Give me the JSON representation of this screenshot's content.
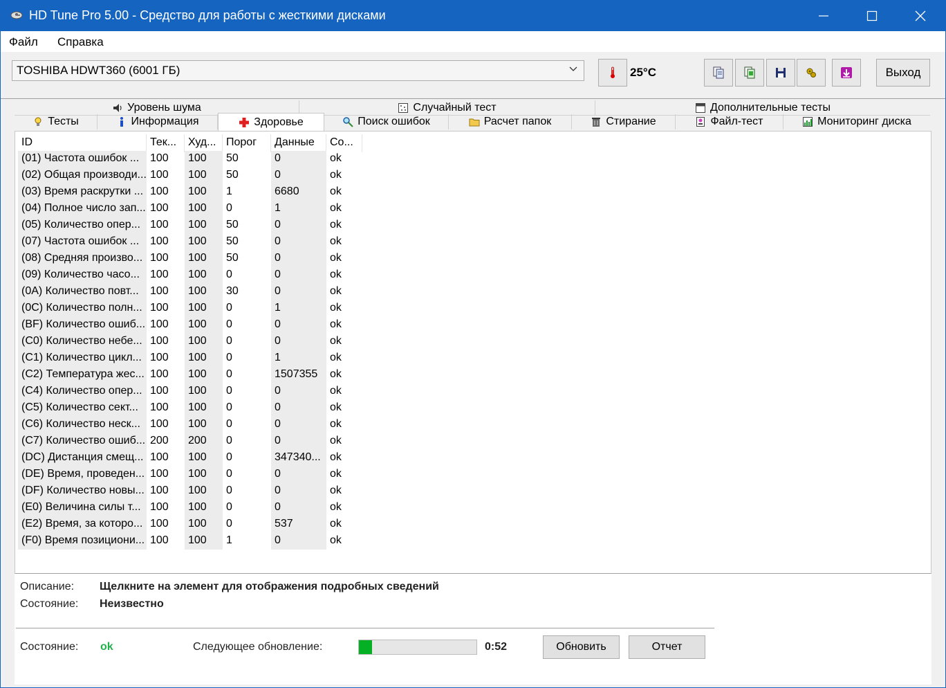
{
  "window": {
    "title": "HD Tune Pro 5.00 - Средство для работы с жесткими дисками"
  },
  "menu": {
    "items": [
      "Файл",
      "Справка"
    ]
  },
  "toolbar": {
    "drive": "TOSHIBA HDWT360 (6001 ГБ)",
    "temperature": "25°C",
    "exit_label": "Выход",
    "icons": [
      "thermometer-icon",
      "copy-text-icon",
      "copy-screenshot-icon",
      "save-icon",
      "options-icon",
      "download-icon"
    ]
  },
  "tabs": {
    "row1": [
      "Уровень шума",
      "Случайный тест",
      "Дополнительные тесты"
    ],
    "row2": [
      "Тесты",
      "Информация",
      "Здоровье",
      "Поиск ошибок",
      "Расчет папок",
      "Стирание",
      "Файл-тест",
      "Мониторинг диска"
    ],
    "active": "Здоровье"
  },
  "smart": {
    "columns": [
      "ID",
      "Тек...",
      "Худ...",
      "Порог",
      "Данные",
      "Со..."
    ],
    "rows": [
      [
        "(01) Частота ошибок ...",
        "100",
        "100",
        "50",
        "0",
        "ok"
      ],
      [
        "(02) Общая производи...",
        "100",
        "100",
        "50",
        "0",
        "ok"
      ],
      [
        "(03) Время раскрутки ...",
        "100",
        "100",
        "1",
        "6680",
        "ok"
      ],
      [
        "(04) Полное число зап...",
        "100",
        "100",
        "0",
        "1",
        "ok"
      ],
      [
        "(05) Количество опер...",
        "100",
        "100",
        "50",
        "0",
        "ok"
      ],
      [
        "(07) Частота ошибок ...",
        "100",
        "100",
        "50",
        "0",
        "ok"
      ],
      [
        "(08) Средняя произво...",
        "100",
        "100",
        "50",
        "0",
        "ok"
      ],
      [
        "(09) Количество часо...",
        "100",
        "100",
        "0",
        "0",
        "ok"
      ],
      [
        "(0A) Количество повт...",
        "100",
        "100",
        "30",
        "0",
        "ok"
      ],
      [
        "(0C) Количество полн...",
        "100",
        "100",
        "0",
        "1",
        "ok"
      ],
      [
        "(BF) Количество ошиб...",
        "100",
        "100",
        "0",
        "0",
        "ok"
      ],
      [
        "(C0) Количество небе...",
        "100",
        "100",
        "0",
        "0",
        "ok"
      ],
      [
        "(C1) Количество цикл...",
        "100",
        "100",
        "0",
        "1",
        "ok"
      ],
      [
        "(C2) Температура жес...",
        "100",
        "100",
        "0",
        "1507355",
        "ok"
      ],
      [
        "(C4) Количество опер...",
        "100",
        "100",
        "0",
        "0",
        "ok"
      ],
      [
        "(C5) Количество сект...",
        "100",
        "100",
        "0",
        "0",
        "ok"
      ],
      [
        "(C6) Количество неск...",
        "100",
        "100",
        "0",
        "0",
        "ok"
      ],
      [
        "(C7) Количество ошиб...",
        "200",
        "200",
        "0",
        "0",
        "ok"
      ],
      [
        "(DC) Дистанция смещ...",
        "100",
        "100",
        "0",
        "347340...",
        "ok"
      ],
      [
        "(DE) Время, проведен...",
        "100",
        "100",
        "0",
        "0",
        "ok"
      ],
      [
        "(DF) Количество новы...",
        "100",
        "100",
        "0",
        "0",
        "ok"
      ],
      [
        "(E0) Величина силы т...",
        "100",
        "100",
        "0",
        "0",
        "ok"
      ],
      [
        "(E2) Время, за которо...",
        "100",
        "100",
        "0",
        "537",
        "ok"
      ],
      [
        "(F0) Время позициони...",
        "100",
        "100",
        "1",
        "0",
        "ok"
      ]
    ]
  },
  "details": {
    "description_label": "Описание:",
    "description_value": "Щелкните на элемент для отображения подробных сведений",
    "state_label": "Состояние:",
    "state_value": "Неизвестно"
  },
  "status": {
    "label": "Состояние:",
    "value": "ok",
    "next_update_label": "Следующее обновление:",
    "progress_fraction": 0.11,
    "time": "0:52",
    "refresh_label": "Обновить",
    "report_label": "Отчет"
  }
}
